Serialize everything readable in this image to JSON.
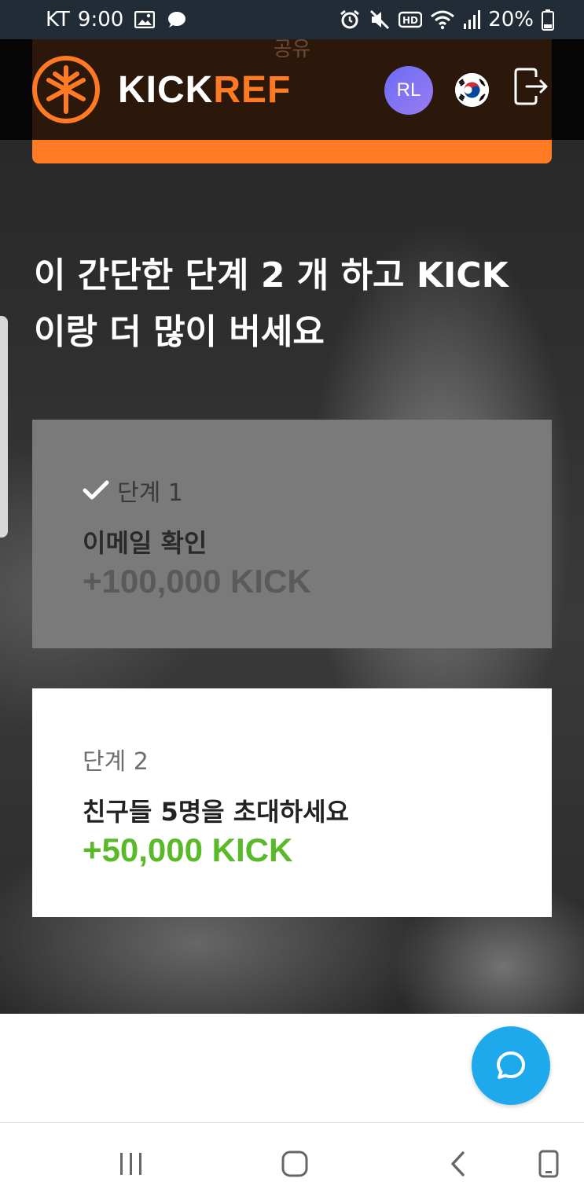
{
  "status_bar": {
    "carrier": "KT",
    "time": "9:00",
    "battery": "20%",
    "icons": [
      "image-icon",
      "chat-bubble-icon",
      "alarm-icon",
      "mute-icon",
      "hd-icon",
      "wifi-icon",
      "signal-icon",
      "battery-icon"
    ]
  },
  "header": {
    "share_text": "공유",
    "logo_part1": "KICK",
    "logo_part2": "REF",
    "avatar_initials": "RL",
    "flag": "korea-flag-icon",
    "logout": "logout-icon"
  },
  "hero": {
    "title_line1": "이 간단한 단계 2 개 하고 KICK",
    "title_line2": "이랑 더 많이 버세요"
  },
  "steps": [
    {
      "label": "단계 1",
      "completed": true,
      "title": "이메일 확인",
      "reward": "+100,000 KICK"
    },
    {
      "label": "단계 2",
      "completed": false,
      "title": "친구들 5명을 초대하세요",
      "reward": "+50,000 KICK"
    }
  ],
  "colors": {
    "brand_orange": "#ff7a22",
    "reward_green": "#5ab928",
    "chat_blue": "#1ea9ec",
    "avatar_purple": "#7b74f3"
  },
  "chat_button": {
    "icon": "chat-icon"
  },
  "nav_bar": {
    "icons": [
      "recent-apps-icon",
      "home-icon",
      "back-icon",
      "rotate-icon"
    ]
  }
}
